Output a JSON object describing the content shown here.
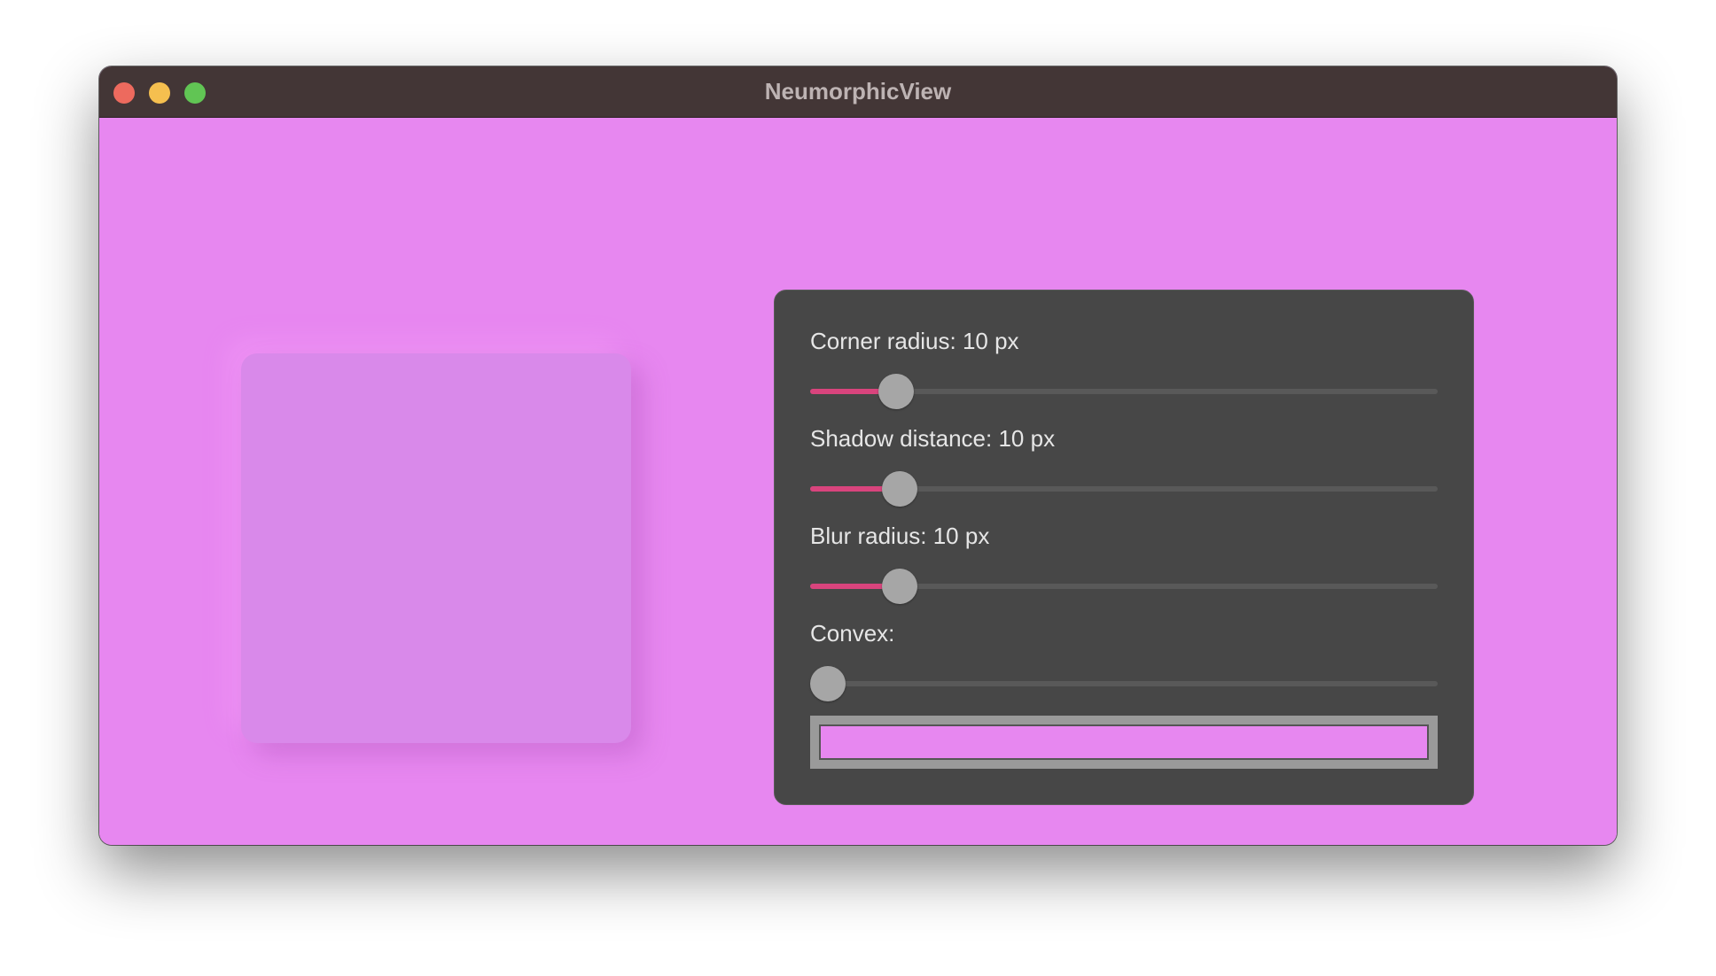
{
  "window": {
    "title": "NeumorphicView"
  },
  "colors": {
    "background": "#e787f0",
    "titlebar": "#433636",
    "panel": "#474747",
    "slider_fill": "#d9447d",
    "slider_thumb": "#a6a6a6",
    "selected_color": "#e787f0"
  },
  "controls": {
    "corner_radius": {
      "label": "Corner radius: 10 px",
      "fraction": 0.115
    },
    "shadow_distance": {
      "label": "Shadow distance: 10 px",
      "fraction": 0.122
    },
    "blur_radius": {
      "label": "Blur radius: 10 px",
      "fraction": 0.122
    },
    "convex": {
      "label": "Convex:",
      "fraction": 0.0
    }
  }
}
